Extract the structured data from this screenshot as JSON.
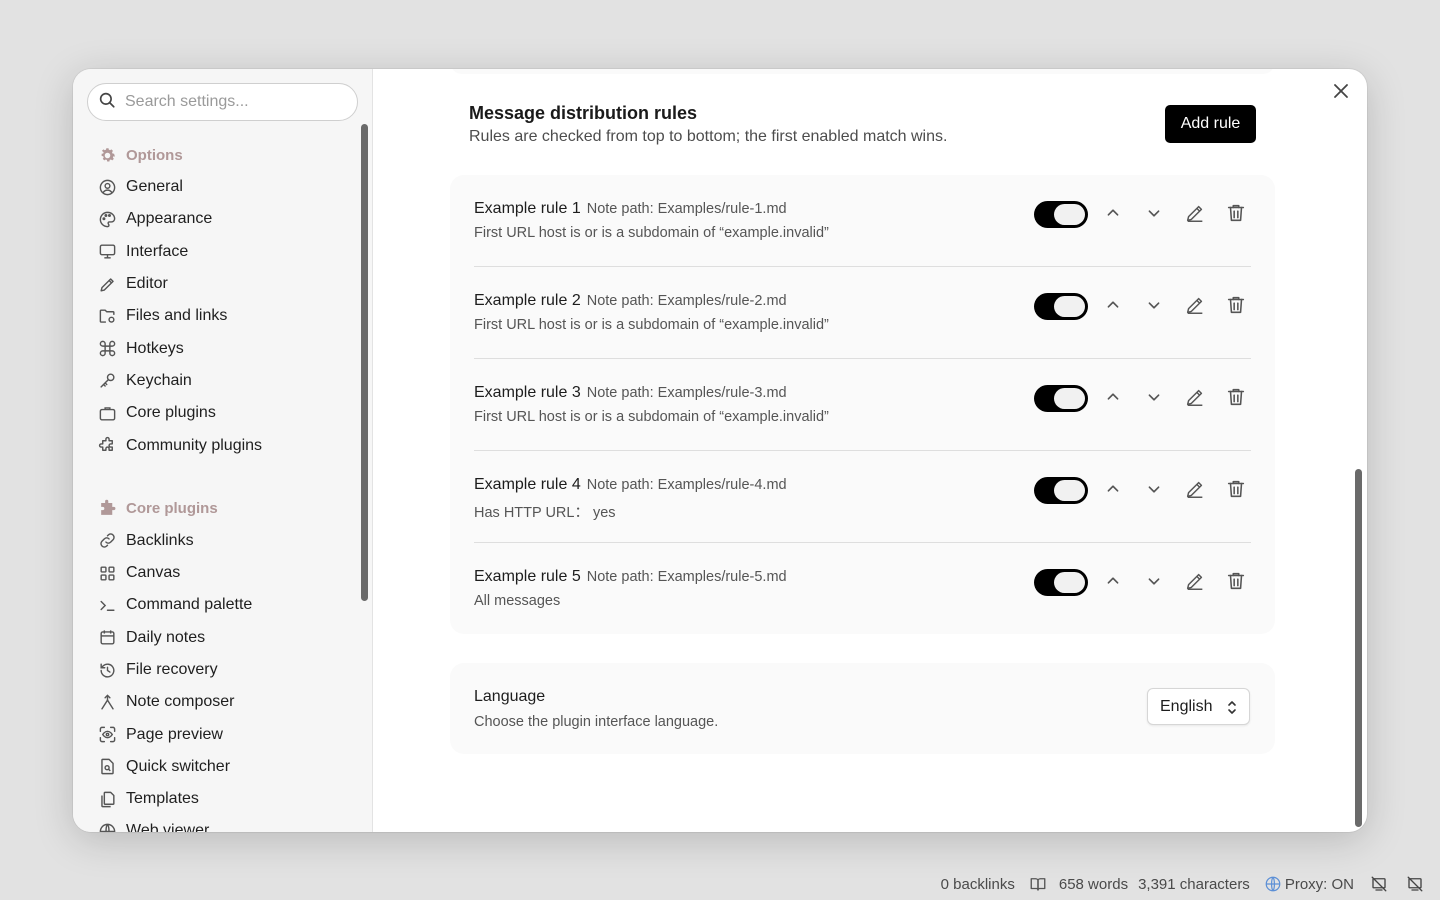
{
  "search": {
    "placeholder": "Search settings..."
  },
  "sidebar": {
    "options_heading": "Options",
    "options_items": [
      {
        "label": "General",
        "icon": "user-circle-icon"
      },
      {
        "label": "Appearance",
        "icon": "palette-icon"
      },
      {
        "label": "Interface",
        "icon": "monitor-icon"
      },
      {
        "label": "Editor",
        "icon": "pencil-icon"
      },
      {
        "label": "Files and links",
        "icon": "folder-cog-icon"
      },
      {
        "label": "Hotkeys",
        "icon": "command-icon"
      },
      {
        "label": "Keychain",
        "icon": "key-icon"
      },
      {
        "label": "Core plugins",
        "icon": "briefcase-icon"
      },
      {
        "label": "Community plugins",
        "icon": "puzzle-icon"
      }
    ],
    "core_heading": "Core plugins",
    "core_items": [
      {
        "label": "Backlinks",
        "icon": "link-icon"
      },
      {
        "label": "Canvas",
        "icon": "grid-icon"
      },
      {
        "label": "Command palette",
        "icon": "terminal-icon"
      },
      {
        "label": "Daily notes",
        "icon": "calendar-icon"
      },
      {
        "label": "File recovery",
        "icon": "history-icon"
      },
      {
        "label": "Note composer",
        "icon": "merge-icon"
      },
      {
        "label": "Page preview",
        "icon": "scan-eye-icon"
      },
      {
        "label": "Quick switcher",
        "icon": "file-search-icon"
      },
      {
        "label": "Templates",
        "icon": "files-icon"
      },
      {
        "label": "Web viewer",
        "icon": "globe-icon"
      }
    ]
  },
  "rules_section": {
    "title": "Message distribution rules",
    "description": "Rules are checked from top to bottom; the first enabled match wins.",
    "add_button": "Add rule",
    "rules": [
      {
        "name": "Example rule 1",
        "path": "Note path: Examples/rule-1.md",
        "condition": "First URL host is or is a subdomain of “example.invalid”",
        "enabled": true
      },
      {
        "name": "Example rule 2",
        "path": "Note path: Examples/rule-2.md",
        "condition": "First URL host is or is a subdomain of “example.invalid”",
        "enabled": true
      },
      {
        "name": "Example rule 3",
        "path": "Note path: Examples/rule-3.md",
        "condition": "First URL host is or is a subdomain of “example.invalid”",
        "enabled": true
      },
      {
        "name": "Example rule 4",
        "path": "Note path: Examples/rule-4.md",
        "condition": "Has HTTP URL： yes",
        "enabled": true
      },
      {
        "name": "Example rule 5",
        "path": "Note path: Examples/rule-5.md",
        "condition": "All messages",
        "enabled": true
      }
    ]
  },
  "language_section": {
    "title": "Language",
    "description": "Choose the plugin interface language.",
    "selected": "English"
  },
  "statusbar": {
    "backlinks": "0 backlinks",
    "words": "658 words",
    "characters": "3,391 characters",
    "proxy": "Proxy: ON"
  },
  "colors": {
    "accent": "#000000",
    "section_heading": "#b09898",
    "card_bg": "#fafafa"
  }
}
